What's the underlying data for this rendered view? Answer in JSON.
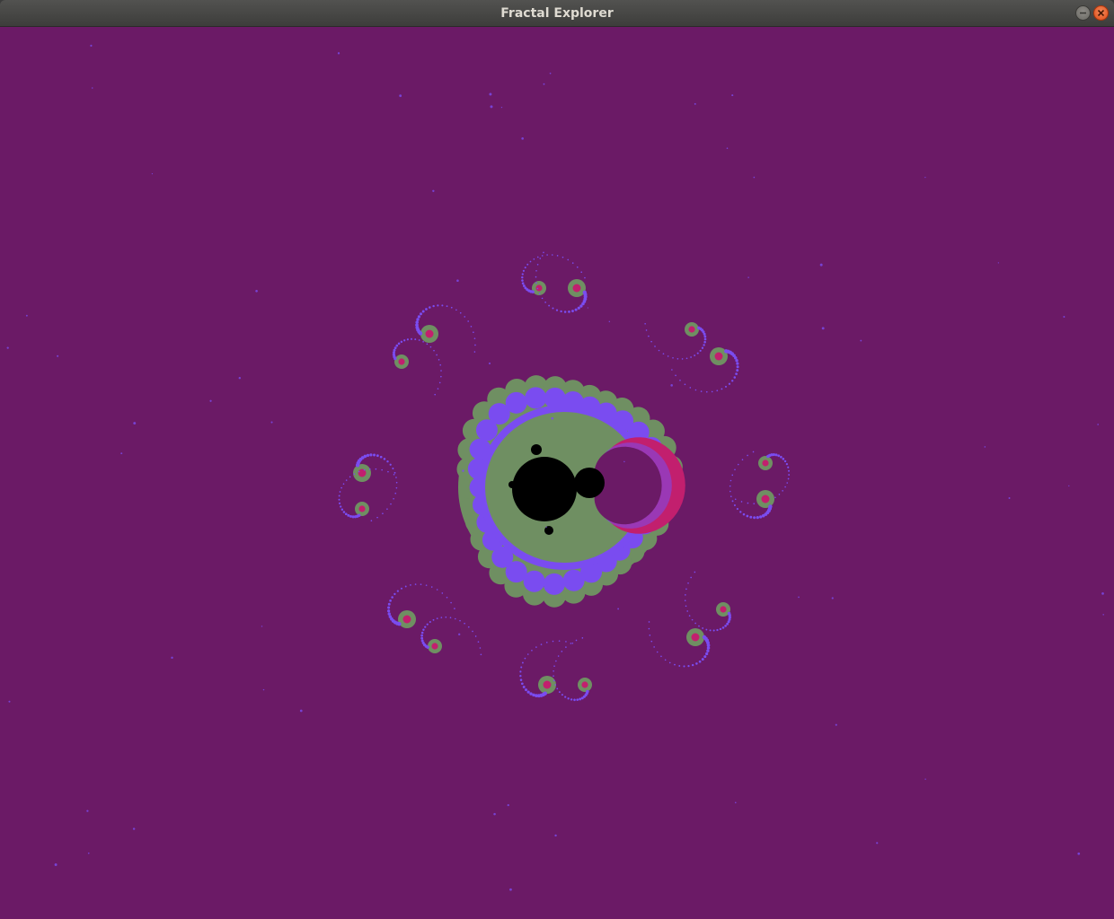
{
  "window": {
    "title": "Fractal Explorer",
    "minimize_icon": "minimize-icon",
    "close_icon": "close-icon"
  },
  "fractal": {
    "type": "mandelbrot",
    "colors": {
      "background": "#6b1a66",
      "set": "#000000",
      "band_violet": "#7a4cf0",
      "band_green": "#6f8f62",
      "band_magenta": "#c21f6e",
      "band_pink": "#d43a86"
    }
  }
}
